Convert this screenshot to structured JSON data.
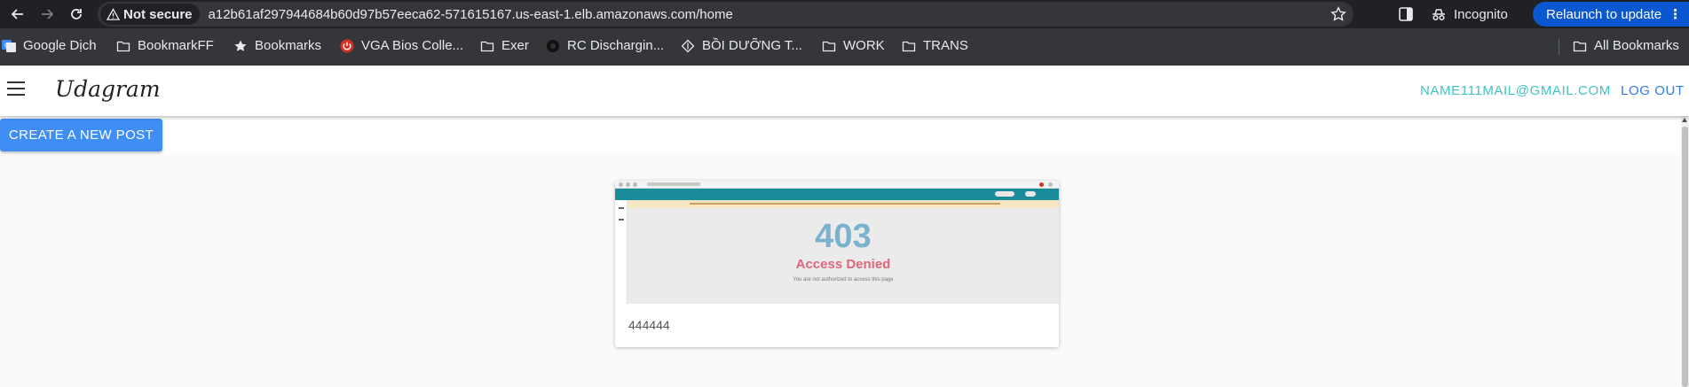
{
  "browser": {
    "security_label": "Not secure",
    "url": "a12b61af297944684b60d97b57eeca62-571615167.us-east-1.elb.amazonaws.com/home",
    "incognito_label": "Incognito",
    "relaunch_label": "Relaunch to update",
    "relaunch_dots": "⋮"
  },
  "bookmarks": {
    "items": [
      {
        "label": "Google Dịch",
        "icon": "google-translate-icon"
      },
      {
        "label": "BookmarkFF",
        "icon": "folder-icon"
      },
      {
        "label": "Bookmarks",
        "icon": "star-icon"
      },
      {
        "label": "VGA Bios Colle...",
        "icon": "power-icon"
      },
      {
        "label": "Exer",
        "icon": "folder-icon"
      },
      {
        "label": "RC Dischargin...",
        "icon": "site-icon"
      },
      {
        "label": "BỒI DƯỠNG T...",
        "icon": "diamond-icon"
      },
      {
        "label": "WORK",
        "icon": "folder-icon"
      },
      {
        "label": "TRANS",
        "icon": "folder-icon"
      }
    ],
    "all_bookmarks_label": "All Bookmarks"
  },
  "app": {
    "logo": "Udagram",
    "user_email": "NAME111MAIL@GMAIL.COM",
    "logout_label": "LOG OUT",
    "create_post_label": "CREATE A NEW POST"
  },
  "post": {
    "image": {
      "error_code": "403",
      "error_title": "Access Denied",
      "error_message": "You are not authorized to access this page"
    },
    "caption": "444444"
  },
  "colors": {
    "chrome_dark": "#202124",
    "bookmark_bar": "#35363a",
    "relaunch": "#0b57d0",
    "email": "#40c4c4",
    "logout": "#2f7de1",
    "primary_button": "#3f8ef5"
  }
}
